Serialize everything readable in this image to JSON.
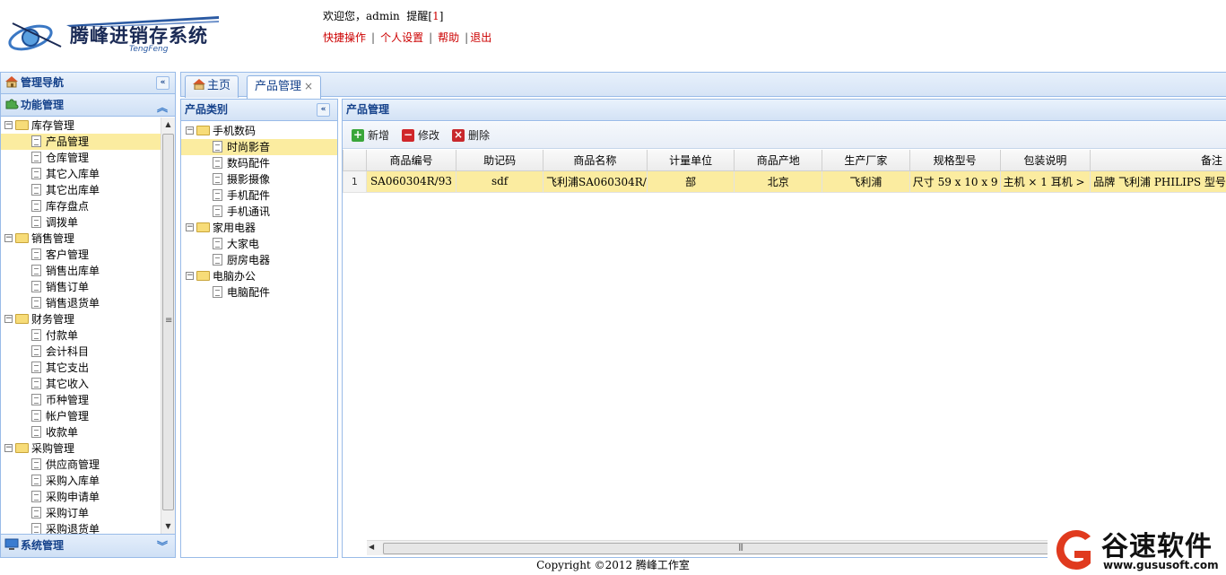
{
  "header": {
    "logo_text": "腾峰进销存系统",
    "logo_sub": "TengFeng",
    "welcome_prefix": "欢迎您，admin  提醒[",
    "reminder_count": "1",
    "welcome_suffix": "]",
    "links": [
      "快捷操作",
      "个人设置",
      "帮助",
      "退出"
    ]
  },
  "nav": {
    "panel_title": "管理导航",
    "section_title": "功能管理",
    "tree": [
      {
        "label": "库存管理",
        "children": [
          "产品管理",
          "仓库管理",
          "其它入库单",
          "其它出库单",
          "库存盘点",
          "调拨单"
        ]
      },
      {
        "label": "销售管理",
        "children": [
          "客户管理",
          "销售出库单",
          "销售订单",
          "销售退货单"
        ]
      },
      {
        "label": "财务管理",
        "children": [
          "付款单",
          "会计科目",
          "其它支出",
          "其它收入",
          "币种管理",
          "帐户管理",
          "收款单"
        ]
      },
      {
        "label": "采购管理",
        "children": [
          "供应商管理",
          "采购入库单",
          "采购申请单",
          "采购订单",
          "采购退货单"
        ]
      }
    ],
    "selected": "产品管理",
    "bottom_section": "系统管理"
  },
  "tabs": [
    {
      "label": "主页",
      "active": false
    },
    {
      "label": "产品管理",
      "active": true,
      "closable": true
    }
  ],
  "category": {
    "title": "产品类别",
    "tree": [
      {
        "label": "手机数码",
        "children": [
          "时尚影音",
          "数码配件",
          "摄影摄像",
          "手机配件",
          "手机通讯"
        ]
      },
      {
        "label": "家用电器",
        "children": [
          "大家电",
          "厨房电器"
        ]
      },
      {
        "label": "电脑办公",
        "children": [
          "电脑配件"
        ]
      }
    ],
    "selected": "时尚影音"
  },
  "product": {
    "title": "产品管理",
    "toolbar": {
      "add": "新增",
      "edit": "修改",
      "delete": "删除"
    },
    "columns": [
      "商品编号",
      "助记码",
      "商品名称",
      "计量单位",
      "商品产地",
      "生产厂家",
      "规格型号",
      "包装说明",
      "备注"
    ],
    "rows": [
      {
        "rownum": "1",
        "cells": [
          "SA060304R/93",
          "sdf",
          "飞利浦SA060304R/",
          "部",
          "北京",
          "飞利浦",
          "尺寸 59 x 10 x 9",
          "主机 × 1 耳机 >",
          "品牌 飞利浦 PHILIPS 型号"
        ]
      }
    ]
  },
  "footer": {
    "copyright": "Copyright ©2012 腾峰工作室"
  },
  "watermark": {
    "title": "谷速软件",
    "url": "www.gususoft.com"
  },
  "colors": {
    "accent_red": "#cc0000",
    "panel_border": "#99bbe8",
    "selected_row": "#fbeca0",
    "header_text": "#15428b"
  }
}
